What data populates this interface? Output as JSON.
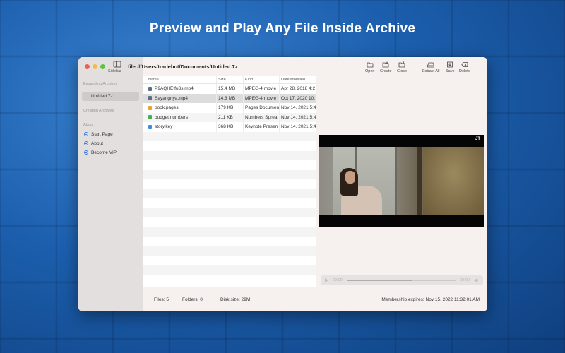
{
  "headline": "Preview and Play Any File Inside Archive",
  "window": {
    "path": "file:///Users/tradebot/Documents/Untitled.7z",
    "sidebar_toggle_label": "Sidebar"
  },
  "toolbar": {
    "open": "Open",
    "create": "Create",
    "close": "Close",
    "extract_all": "Extract All",
    "save": "Save",
    "delete": "Delete"
  },
  "sidebar": {
    "expanding_title": "Expanding Archives",
    "active_archive": "Untitled.7z",
    "creating_title": "Creating Archives",
    "about_title": "About",
    "links": [
      "Start Page",
      "About",
      "Become VIP"
    ]
  },
  "file_table": {
    "headers": [
      "Name",
      "Size",
      "Kind",
      "Date Modified"
    ],
    "rows": [
      {
        "name": "P9AQHEtfu3s.mp4",
        "size": "15.4 MB",
        "kind": "MPEG-4 movie",
        "date": "Apr 28, 2018 4:2",
        "icon": "video-file-icon",
        "color": "#5a6e8a"
      },
      {
        "name": "Sayangnya.mp4",
        "size": "14.3 MB",
        "kind": "MPEG-4 movie",
        "date": "Oct 17, 2020 10:",
        "icon": "video-file-icon",
        "color": "#5a6e8a"
      },
      {
        "name": "book.pages",
        "size": "179 KB",
        "kind": "Pages Documen",
        "date": "Nov 14, 2021 5:4",
        "icon": "pages-file-icon",
        "color": "#f0a030"
      },
      {
        "name": "budget.numbers",
        "size": "211 KB",
        "kind": "Numbers Sprea",
        "date": "Nov 14, 2021 5:4",
        "icon": "numbers-file-icon",
        "color": "#3fb34f"
      },
      {
        "name": "story.key",
        "size": "368 KB",
        "kind": "Keynote Presen",
        "date": "Nov 14, 2021 5:4",
        "icon": "keynote-file-icon",
        "color": "#3c8ce0"
      }
    ],
    "selected_index": 1
  },
  "player": {
    "elapsed": "00:00",
    "remaining": "00:00",
    "progress": 0.6,
    "logo": "JT"
  },
  "status": {
    "files": "Files: 5",
    "folders": "Folders: 0",
    "disk_size": "Disk size: 29M",
    "membership": "Membership expires: Nov 15, 2022 11:32:01 AM"
  }
}
